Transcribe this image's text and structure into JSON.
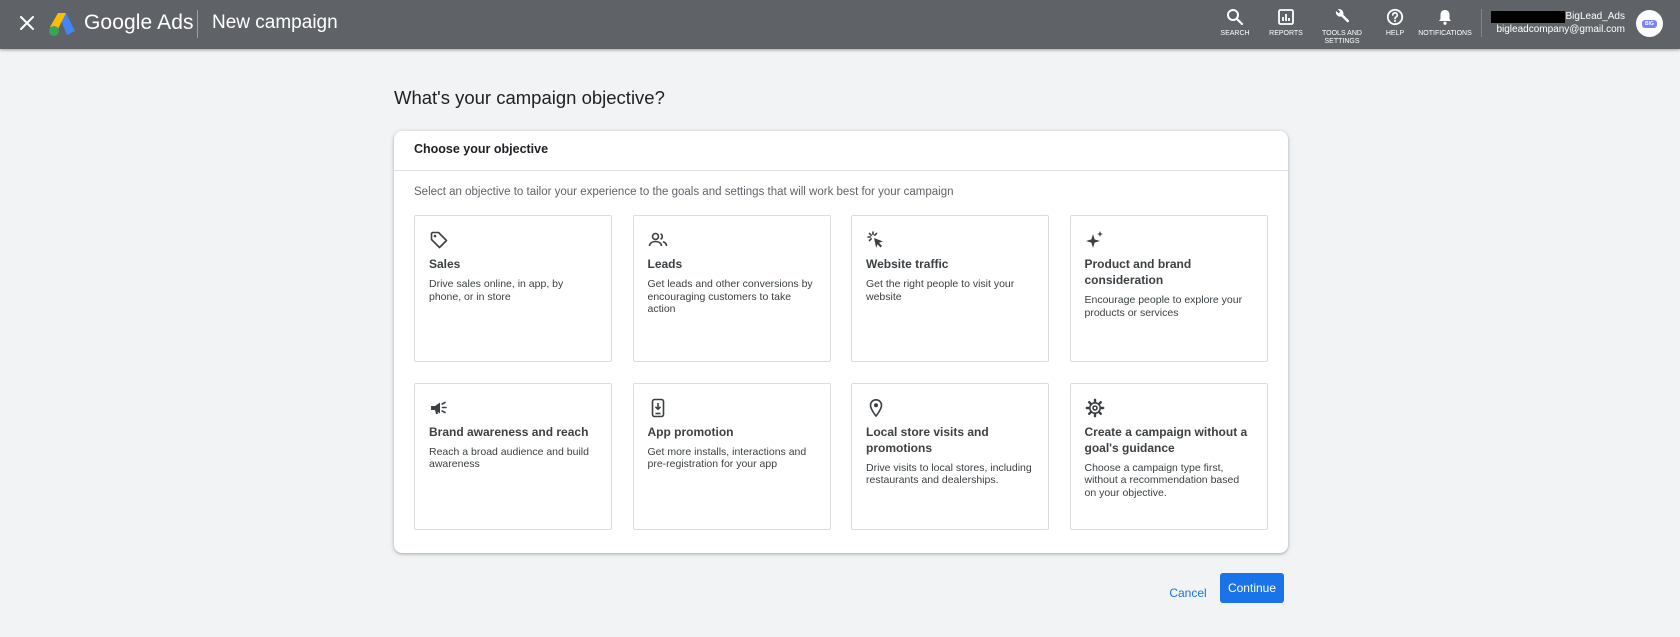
{
  "topbar": {
    "product_name": "Google Ads",
    "page_title": "New campaign",
    "tools": [
      {
        "label": "SEARCH",
        "icon": "search-icon"
      },
      {
        "label": "REPORTS",
        "icon": "reports-icon"
      },
      {
        "label": "TOOLS AND SETTINGS",
        "icon": "wrench-icon"
      },
      {
        "label": "HELP",
        "icon": "help-icon"
      },
      {
        "label": "NOTIFICATIONS",
        "icon": "bell-icon"
      }
    ],
    "account": {
      "name": "BigLead_Ads",
      "email": "bigleadcompany@gmail.com",
      "avatar_text": "BIG"
    }
  },
  "main": {
    "heading": "What's your campaign objective?",
    "card_title": "Choose your objective",
    "card_subtitle": "Select an objective to tailor your experience to the goals and settings that will work best for your campaign",
    "objectives": [
      {
        "title": "Sales",
        "description": "Drive sales online, in app, by phone, or in store",
        "icon": "tag-icon"
      },
      {
        "title": "Leads",
        "description": "Get leads and other conversions by encouraging customers to take action",
        "icon": "people-icon"
      },
      {
        "title": "Website traffic",
        "description": "Get the right people to visit your website",
        "icon": "cursor-click-icon"
      },
      {
        "title": "Product and brand consideration",
        "description": "Encourage people to explore your products or services",
        "icon": "sparkle-icon"
      },
      {
        "title": "Brand awareness and reach",
        "description": "Reach a broad audience and build awareness",
        "icon": "megaphone-icon"
      },
      {
        "title": "App promotion",
        "description": "Get more installs, interactions and pre-registration for your app",
        "icon": "phone-download-icon"
      },
      {
        "title": "Local store visits and promotions",
        "description": "Drive visits to local stores, including restaurants and dealerships.",
        "icon": "location-pin-icon"
      },
      {
        "title": "Create a campaign without a goal's guidance",
        "description": "Choose a campaign type first, without a recommendation based on your objective.",
        "icon": "gear-icon"
      }
    ]
  },
  "footer": {
    "cancel_label": "Cancel",
    "continue_label": "Continue"
  },
  "colors": {
    "topbar": "#5f6368",
    "background": "#f1f3f4",
    "accent": "#1a73e8"
  }
}
